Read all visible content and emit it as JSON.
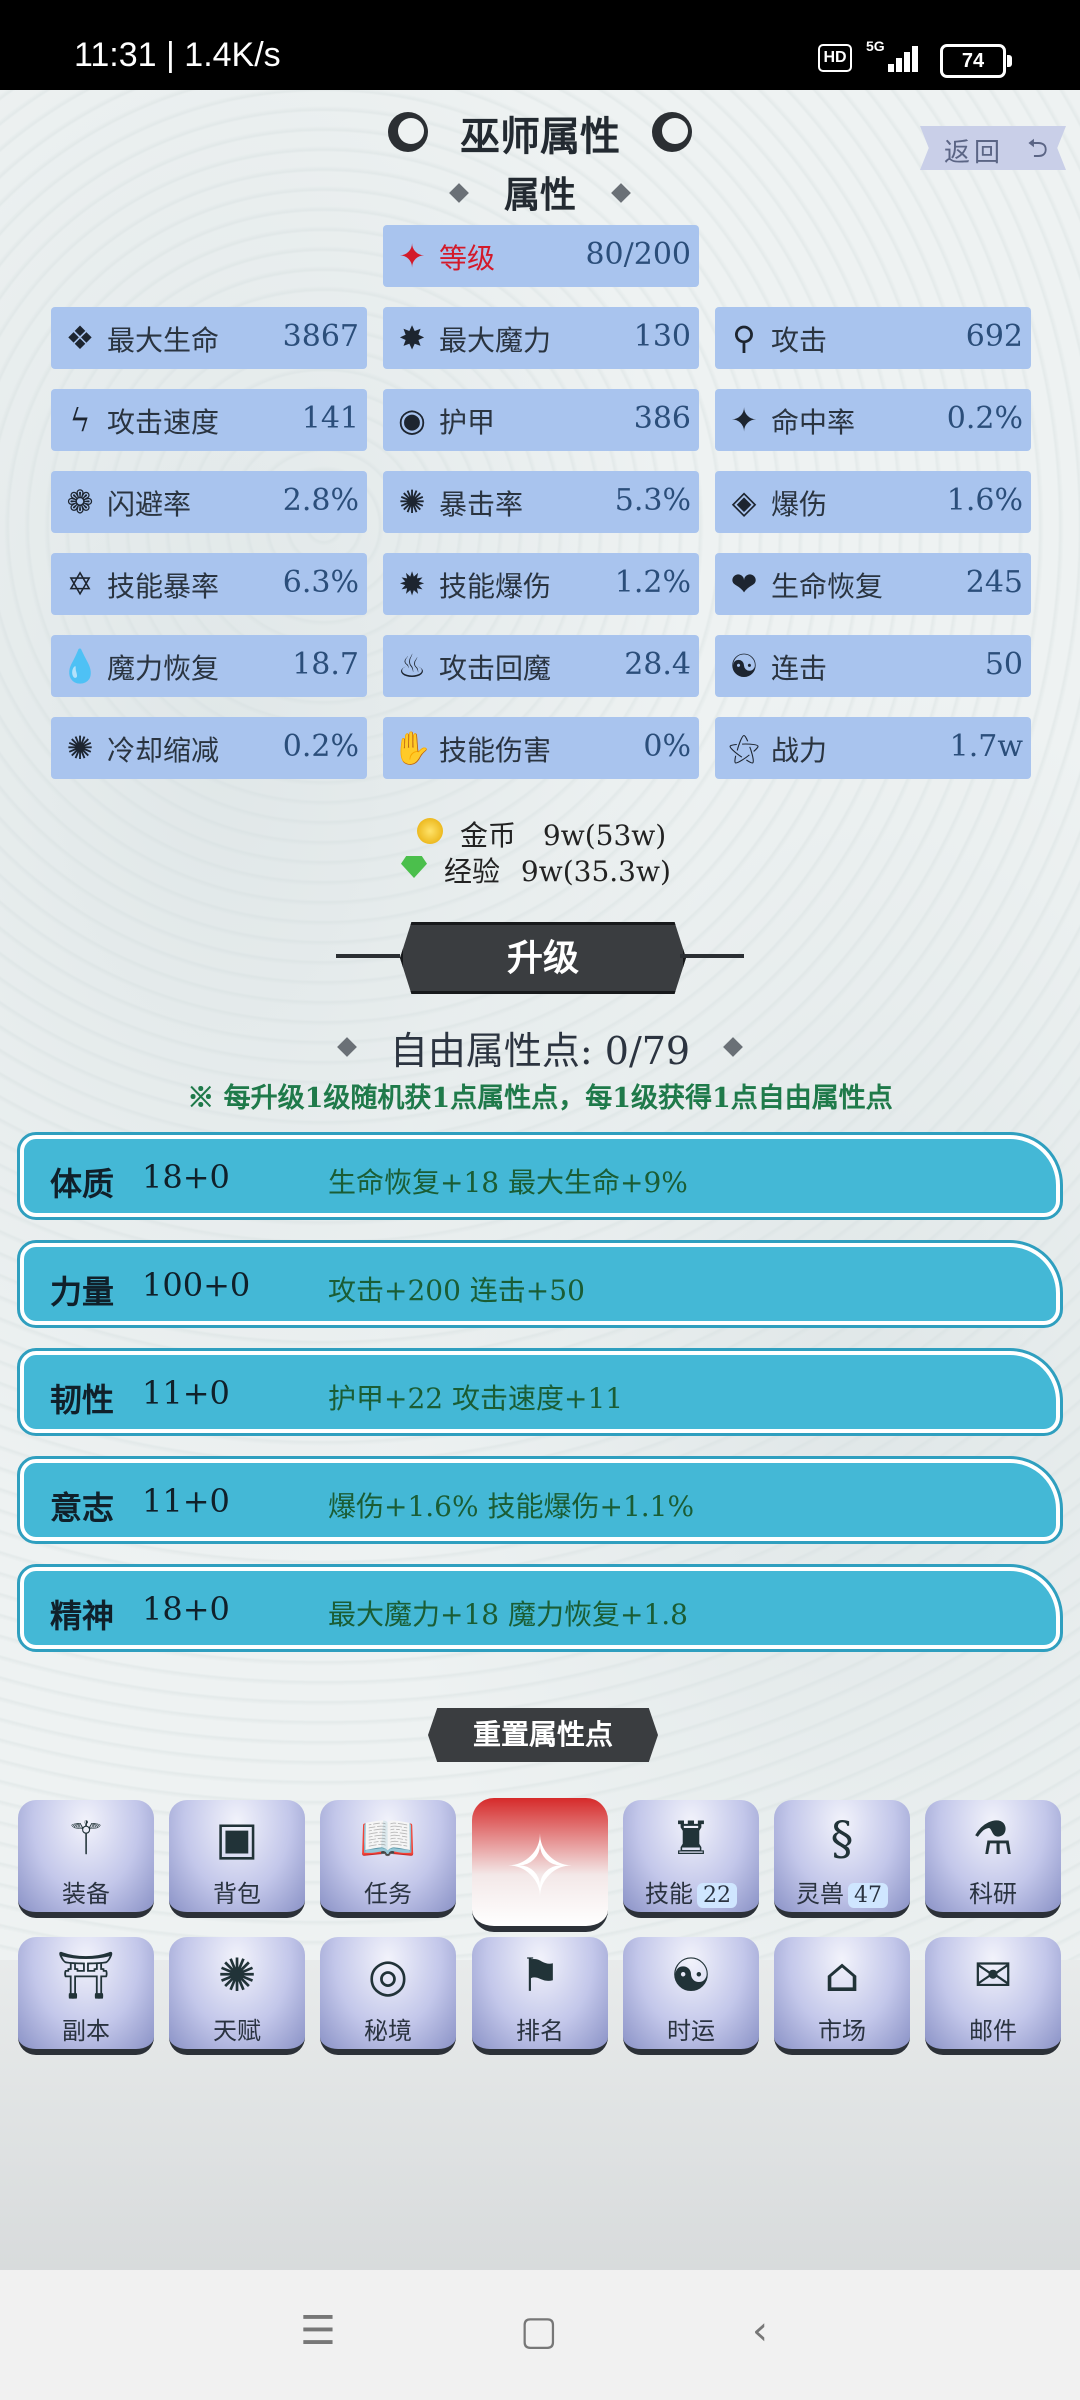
{
  "status_bar": {
    "time": "11:31 | 1.4K/s",
    "hd": "HD",
    "network": "5G",
    "battery": "74"
  },
  "header": {
    "title": "巫师属性",
    "return_label": "返回",
    "return_icon": "return-arrow-icon",
    "section_title": "属性"
  },
  "level": {
    "label": "等级",
    "value": "80/200",
    "color": "#d31a2a"
  },
  "stats": [
    {
      "label": "最大生命",
      "value": "3867",
      "icon": "heart-shield-icon"
    },
    {
      "label": "最大魔力",
      "value": "130",
      "icon": "magic-burst-icon"
    },
    {
      "label": "攻击",
      "value": "692",
      "icon": "key-icon"
    },
    {
      "label": "攻击速度",
      "value": "141",
      "icon": "lightning-icon"
    },
    {
      "label": "护甲",
      "value": "386",
      "icon": "ring-icon"
    },
    {
      "label": "命中率",
      "value": "0.2%",
      "icon": "target-star-icon"
    },
    {
      "label": "闪避率",
      "value": "2.8%",
      "icon": "triskelion-icon"
    },
    {
      "label": "暴击率",
      "value": "5.3%",
      "icon": "spiral-icon"
    },
    {
      "label": "爆伤",
      "value": "1.6%",
      "icon": "broken-shield-icon"
    },
    {
      "label": "技能暴率",
      "value": "6.3%",
      "icon": "hexagram-icon"
    },
    {
      "label": "技能爆伤",
      "value": "1.2%",
      "icon": "explosion-icon"
    },
    {
      "label": "生命恢复",
      "value": "245",
      "icon": "heart-plus-icon"
    },
    {
      "label": "魔力恢复",
      "value": "18.7",
      "icon": "drop-icon"
    },
    {
      "label": "攻击回魔",
      "value": "28.4",
      "icon": "flame-icon"
    },
    {
      "label": "连击",
      "value": "50",
      "icon": "double-swirl-icon"
    },
    {
      "label": "冷却缩减",
      "value": "0.2%",
      "icon": "gear-burst-icon"
    },
    {
      "label": "技能伤害",
      "value": "0%",
      "icon": "skill-hand-icon"
    },
    {
      "label": "战力",
      "value": "1.7w",
      "icon": "power-star-icon"
    }
  ],
  "currency": {
    "gold_label": "金币",
    "gold_value": "9w(53w)",
    "exp_label": "经验",
    "exp_value": "9w(35.3w)"
  },
  "upgrade_button": "升级",
  "free_points": "自由属性点: 0/79",
  "note": "※ 每升级1级随机获1点属性点，每1级获得1点自由属性点",
  "attributes": [
    {
      "name": "体质",
      "points": "18+0",
      "effect": "生命恢复+18  最大生命+9%"
    },
    {
      "name": "力量",
      "points": "100+0",
      "effect": "攻击+200  连击+50"
    },
    {
      "name": "韧性",
      "points": "11+0",
      "effect": "护甲+22  攻击速度+11"
    },
    {
      "name": "意志",
      "points": "11+0",
      "effect": "爆伤+1.6%  技能爆伤+1.1%"
    },
    {
      "name": "精神",
      "points": "18+0",
      "effect": "最大魔力+18  魔力恢复+1.8"
    }
  ],
  "reset_button": "重置属性点",
  "menu_row1": [
    {
      "label": "装备",
      "icon": "wand-icon",
      "glyph": "⚚"
    },
    {
      "label": "背包",
      "icon": "chest-icon",
      "glyph": "▣"
    },
    {
      "label": "任务",
      "icon": "book-icon",
      "glyph": "📖"
    },
    {
      "label": "技能",
      "badge": "22",
      "icon": "skill-books-icon",
      "glyph": "♜"
    },
    {
      "label": "灵兽",
      "badge": "47",
      "icon": "dragon-icon",
      "glyph": "§"
    },
    {
      "label": "科研",
      "icon": "potion-icon",
      "glyph": "⚗"
    }
  ],
  "menu_row2": [
    {
      "label": "副本",
      "icon": "banner-icon",
      "glyph": "⛩"
    },
    {
      "label": "天赋",
      "icon": "medallion-icon",
      "glyph": "✺"
    },
    {
      "label": "秘境",
      "icon": "vortex-icon",
      "glyph": "◎"
    },
    {
      "label": "排名",
      "icon": "rank-signpost-icon",
      "glyph": "⚑"
    },
    {
      "label": "时运",
      "icon": "fortune-wheel-icon",
      "glyph": "☯"
    },
    {
      "label": "市场",
      "icon": "shop-icon",
      "glyph": "⌂"
    },
    {
      "label": "邮件",
      "icon": "mail-icon",
      "glyph": "✉"
    }
  ],
  "center_logo_icon": "wizard-star-logo-icon"
}
